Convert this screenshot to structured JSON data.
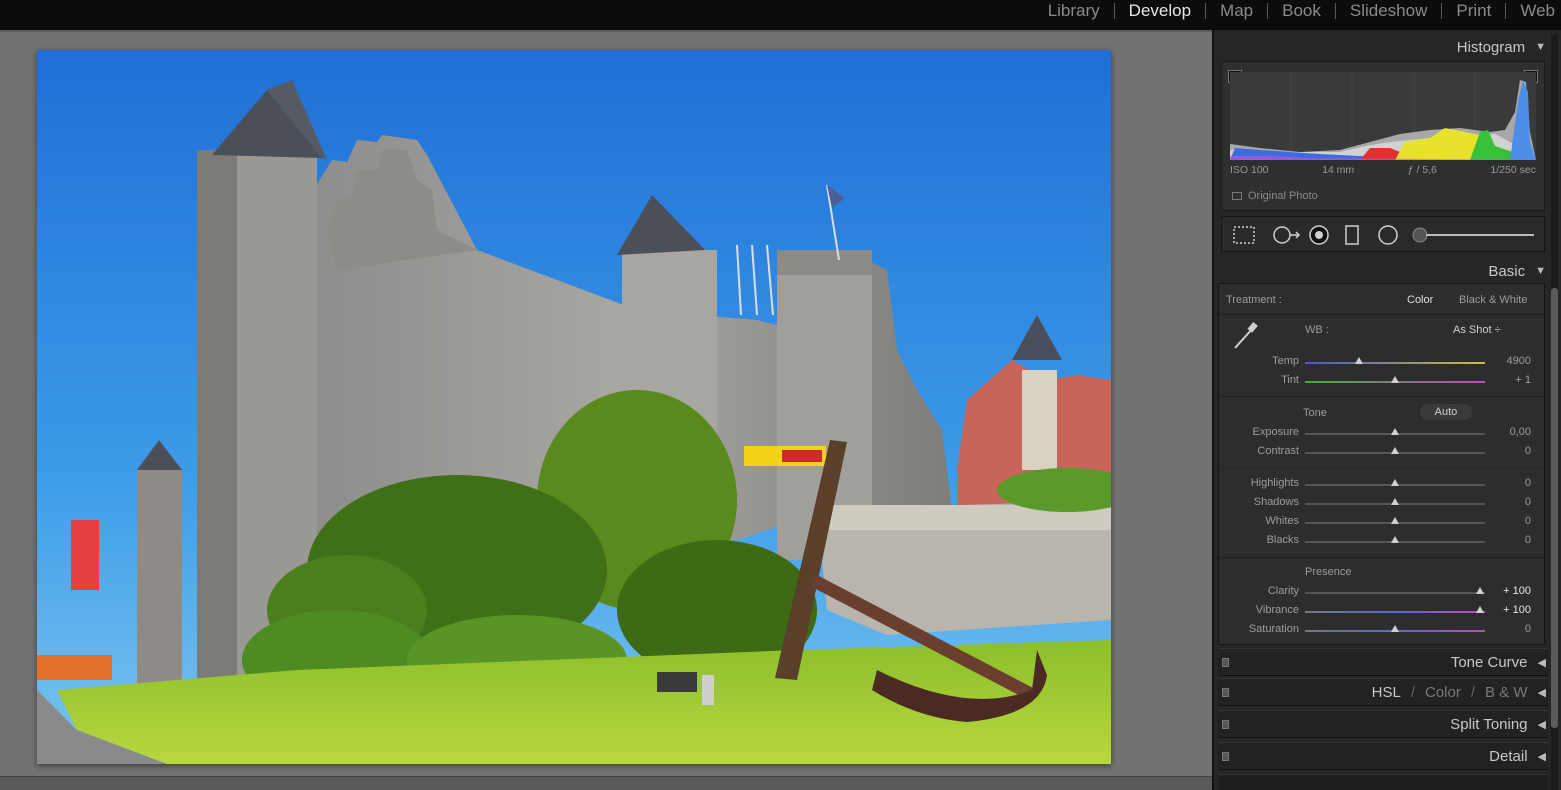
{
  "modules": [
    "Library",
    "Develop",
    "Map",
    "Book",
    "Slideshow",
    "Print",
    "Web"
  ],
  "active_module": "Develop",
  "histogram": {
    "title": "Histogram",
    "exif": {
      "iso": "ISO 100",
      "focal": "14 mm",
      "aperture": "ƒ / 5,6",
      "shutter": "1/250 sec"
    },
    "original_photo_label": "Original Photo"
  },
  "tools": [
    "crop-overlay-icon",
    "spot-removal-icon",
    "red-eye-icon",
    "graduated-filter-icon",
    "radial-filter-icon",
    "adjustment-brush-icon"
  ],
  "basic": {
    "title": "Basic",
    "treatment_label": "Treatment :",
    "treatment_color": "Color",
    "treatment_bw": "Black & White",
    "wb_label": "WB :",
    "wb_value": "As Shot ÷",
    "tone_label": "Tone",
    "auto_label": "Auto",
    "presence_label": "Presence",
    "sliders": {
      "temp": {
        "label": "Temp",
        "value": "4900",
        "pos": 0.3
      },
      "tint": {
        "label": "Tint",
        "value": "+ 1",
        "pos": 0.5
      },
      "exposure": {
        "label": "Exposure",
        "value": "0,00",
        "pos": 0.5
      },
      "contrast": {
        "label": "Contrast",
        "value": "0",
        "pos": 0.5
      },
      "highlights": {
        "label": "Highlights",
        "value": "0",
        "pos": 0.5
      },
      "shadows": {
        "label": "Shadows",
        "value": "0",
        "pos": 0.5
      },
      "whites": {
        "label": "Whites",
        "value": "0",
        "pos": 0.5
      },
      "blacks": {
        "label": "Blacks",
        "value": "0",
        "pos": 0.5
      },
      "clarity": {
        "label": "Clarity",
        "value": "+ 100",
        "pos": 0.97
      },
      "vibrance": {
        "label": "Vibrance",
        "value": "+ 100",
        "pos": 0.97
      },
      "saturation": {
        "label": "Saturation",
        "value": "0",
        "pos": 0.5
      }
    }
  },
  "panels": {
    "tone_curve": "Tone Curve",
    "hsl": "HSL",
    "color": "Color",
    "bw": "B & W",
    "split_toning": "Split Toning",
    "detail": "Detail"
  }
}
